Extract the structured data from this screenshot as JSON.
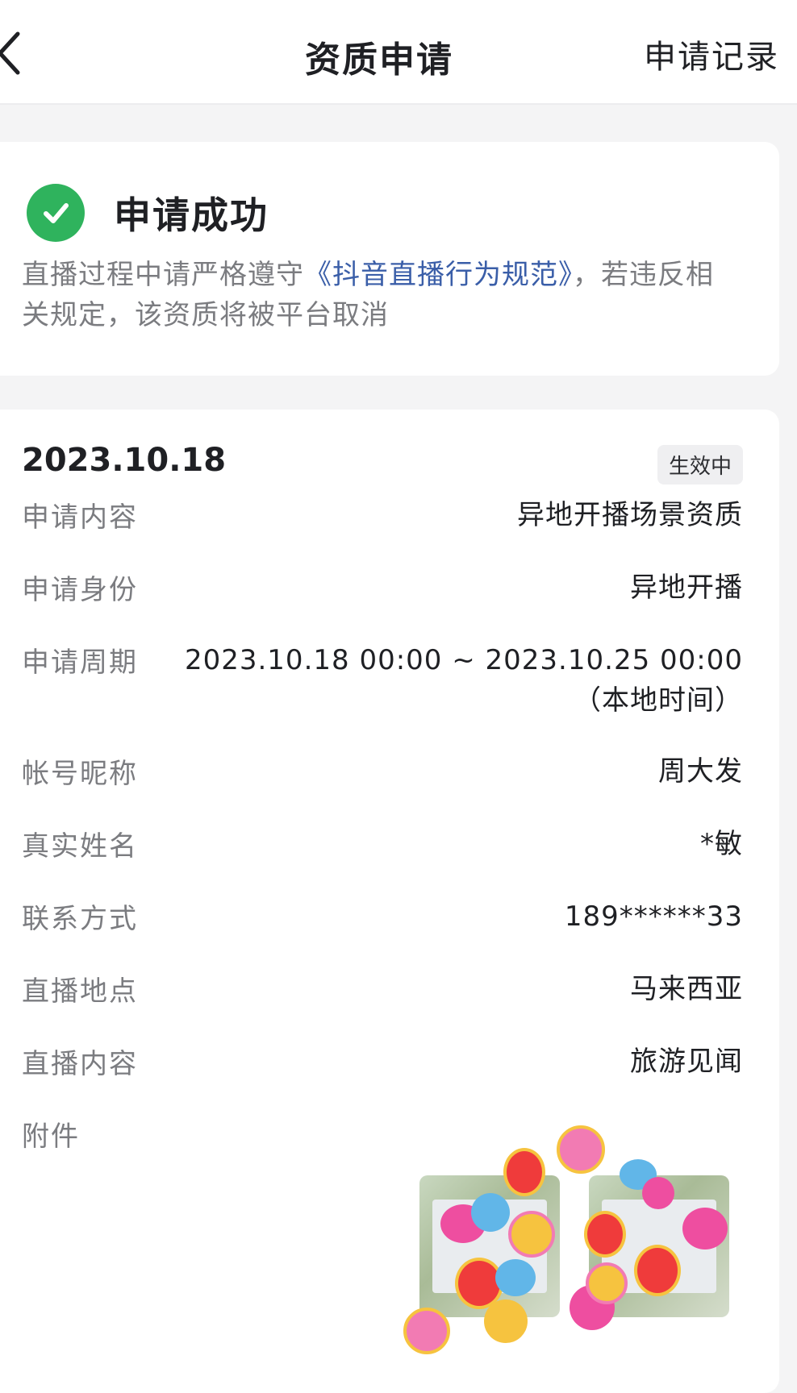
{
  "nav": {
    "title": "资质申请",
    "right": "申请记录"
  },
  "status": {
    "title": "申请成功",
    "notice_before": "直播过程中请严格遵守",
    "notice_link": "《抖音直播行为规范》",
    "notice_after": "，若违反相关规定，该资质将被平台取消"
  },
  "detail": {
    "date": "2023.10.18",
    "badge": "生效中",
    "rows": [
      {
        "label": "申请内容",
        "value": "异地开播场景资质"
      },
      {
        "label": "申请身份",
        "value": "异地开播"
      },
      {
        "label": "申请周期",
        "value": "2023.10.18 00:00 ~ 2023.10.25 00:00",
        "note": "（本地时间）"
      },
      {
        "label": "帐号昵称",
        "value": "周大发"
      },
      {
        "label": "真实姓名",
        "value": "*敏"
      },
      {
        "label": "联系方式",
        "value": "189******33"
      },
      {
        "label": "直播地点",
        "value": "马来西亚"
      },
      {
        "label": "直播内容",
        "value": "旅游见闻"
      },
      {
        "label": "附件",
        "value": ""
      }
    ]
  },
  "colors": {
    "success": "#2fb35d",
    "link": "#3a5ea8"
  },
  "icons": {
    "back": "chevron-left-icon",
    "status": "check-circle-icon"
  }
}
